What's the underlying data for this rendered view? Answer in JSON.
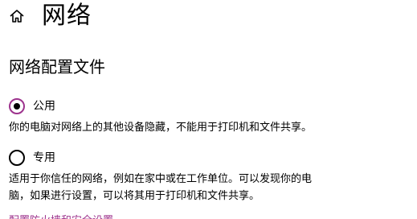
{
  "header": {
    "icon": "home-icon",
    "title": "网络"
  },
  "section": {
    "title": "网络配置文件"
  },
  "colors": {
    "accent": "#9d338d"
  },
  "options": [
    {
      "label": "公用",
      "checked": true,
      "description": "你的电脑对网络上的其他设备隐藏，不能用于打印机和文件共享。"
    },
    {
      "label": "专用",
      "checked": false,
      "description_line1": "适用于你信任的网络，例如在家中或在工作单位。可以发现你的电",
      "description_line2": "脑，如果进行设置，可以将其用于打印机和文件共享。"
    }
  ],
  "link": {
    "text": "配置防火墙和安全设置"
  }
}
